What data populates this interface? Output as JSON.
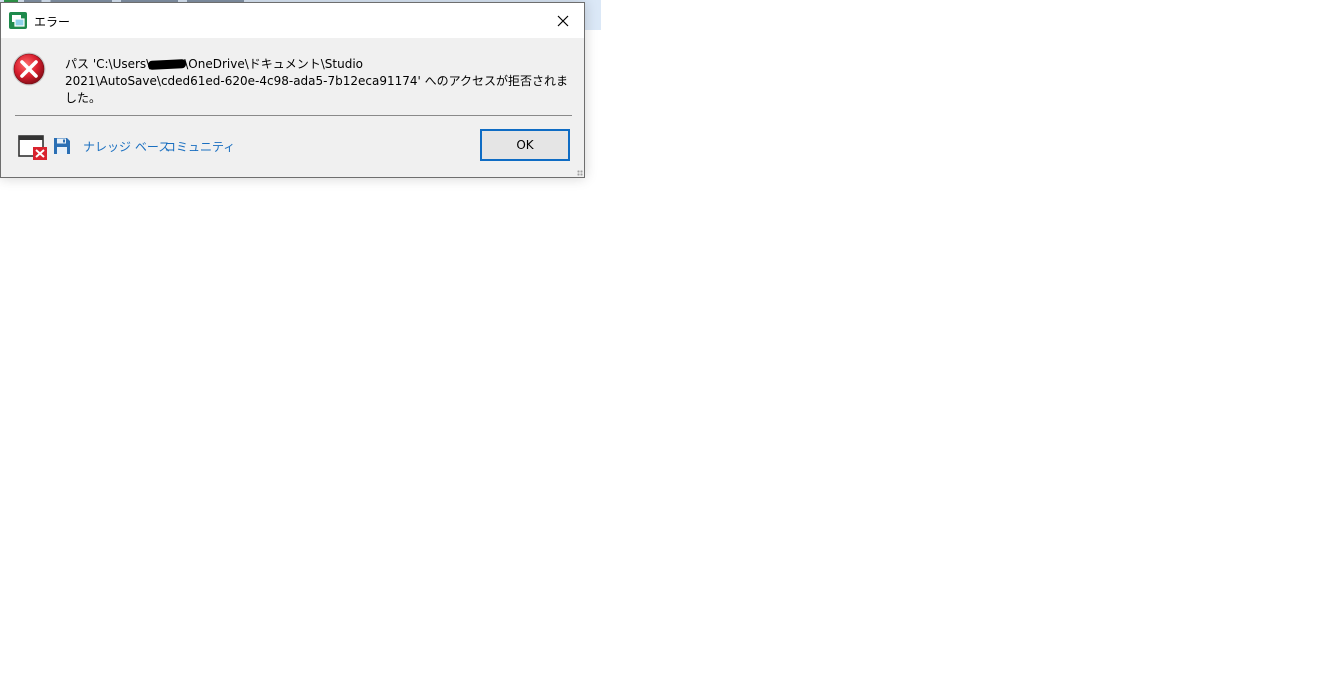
{
  "dialog": {
    "title": "エラー",
    "message_part1": "パス 'C:\\Users\\",
    "message_part2": "\\OneDrive\\ドキュメント\\Studio\n2021\\AutoSave\\cded61ed-620e-4c98-ada5-7b12eca91174' へのアクセスが拒否されました。",
    "ok_label": "OK",
    "links": {
      "knowledge_base": "ナレッジ ベース",
      "community": "コミュニティ"
    }
  },
  "icons": {
    "app": "app-icon",
    "close": "close-icon",
    "error": "error-icon",
    "dismiss_window": "window-close-icon",
    "save": "save-icon"
  },
  "colors": {
    "link": "#1a6fc0",
    "ok_border": "#0f6cc4",
    "error_red": "#c8142b",
    "dialog_bg": "#f0f0f0"
  }
}
